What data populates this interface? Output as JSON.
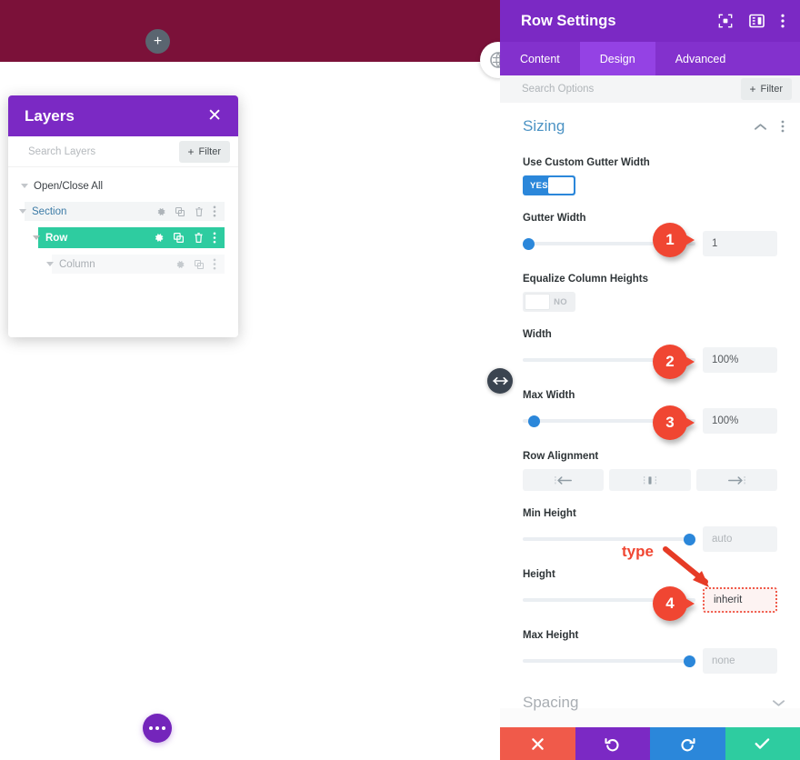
{
  "canvas": {
    "add_section_label": "+",
    "band_color": "#7b1139",
    "more_button": "more-options",
    "globe_button": "page-settings"
  },
  "layers": {
    "title": "Layers",
    "close_label": "✕",
    "search_placeholder": "Search Layers",
    "filter_label": "Filter",
    "filter_plus": "+",
    "open_close_all": "Open/Close All",
    "rows": [
      {
        "label": "Section",
        "icons": [
          "gear",
          "duplicate",
          "trash",
          "dots"
        ]
      },
      {
        "label": "Row",
        "icons": [
          "gear",
          "duplicate",
          "trash",
          "dots"
        ]
      },
      {
        "label": "Column",
        "icons": [
          "gear",
          "duplicate",
          "dots"
        ]
      }
    ],
    "active_color": "#2ecca0",
    "header_color": "#7b29c4"
  },
  "settings": {
    "title": "Row Settings",
    "header_icons": [
      "focus-icon",
      "layout-icon",
      "kebab-icon"
    ],
    "tabs": [
      {
        "label": "Content",
        "active": false
      },
      {
        "label": "Design",
        "active": true
      },
      {
        "label": "Advanced",
        "active": false
      }
    ],
    "search_placeholder": "Search Options",
    "filter_label": "Filter",
    "filter_plus": "+",
    "section": {
      "title": "Sizing",
      "collapsed": false
    },
    "fields": {
      "gutter_toggle_label": "Use Custom Gutter Width",
      "gutter_toggle_value": "YES",
      "gutter_width_label": "Gutter Width",
      "gutter_width_value": "1",
      "equalize_label": "Equalize Column Heights",
      "equalize_value": "NO",
      "width_label": "Width",
      "width_value": "100%",
      "max_width_label": "Max Width",
      "max_width_value": "100%",
      "row_alignment_label": "Row Alignment",
      "min_height_label": "Min Height",
      "min_height_value": "auto",
      "height_label": "Height",
      "height_value": "inherit",
      "max_height_label": "Max Height",
      "max_height_value": "none"
    },
    "spacing_title": "Spacing",
    "actions": [
      {
        "name": "discard",
        "glyph": "✕",
        "color": "#f05a4a"
      },
      {
        "name": "undo",
        "glyph": "↺",
        "color": "#7b29c4"
      },
      {
        "name": "redo",
        "glyph": "↻",
        "color": "#2b87da"
      },
      {
        "name": "save",
        "glyph": "✓",
        "color": "#2ecca0"
      }
    ]
  },
  "annotations": {
    "callouts": [
      "1",
      "2",
      "3",
      "4"
    ],
    "type_note": "type",
    "accent_color": "#f04632"
  }
}
